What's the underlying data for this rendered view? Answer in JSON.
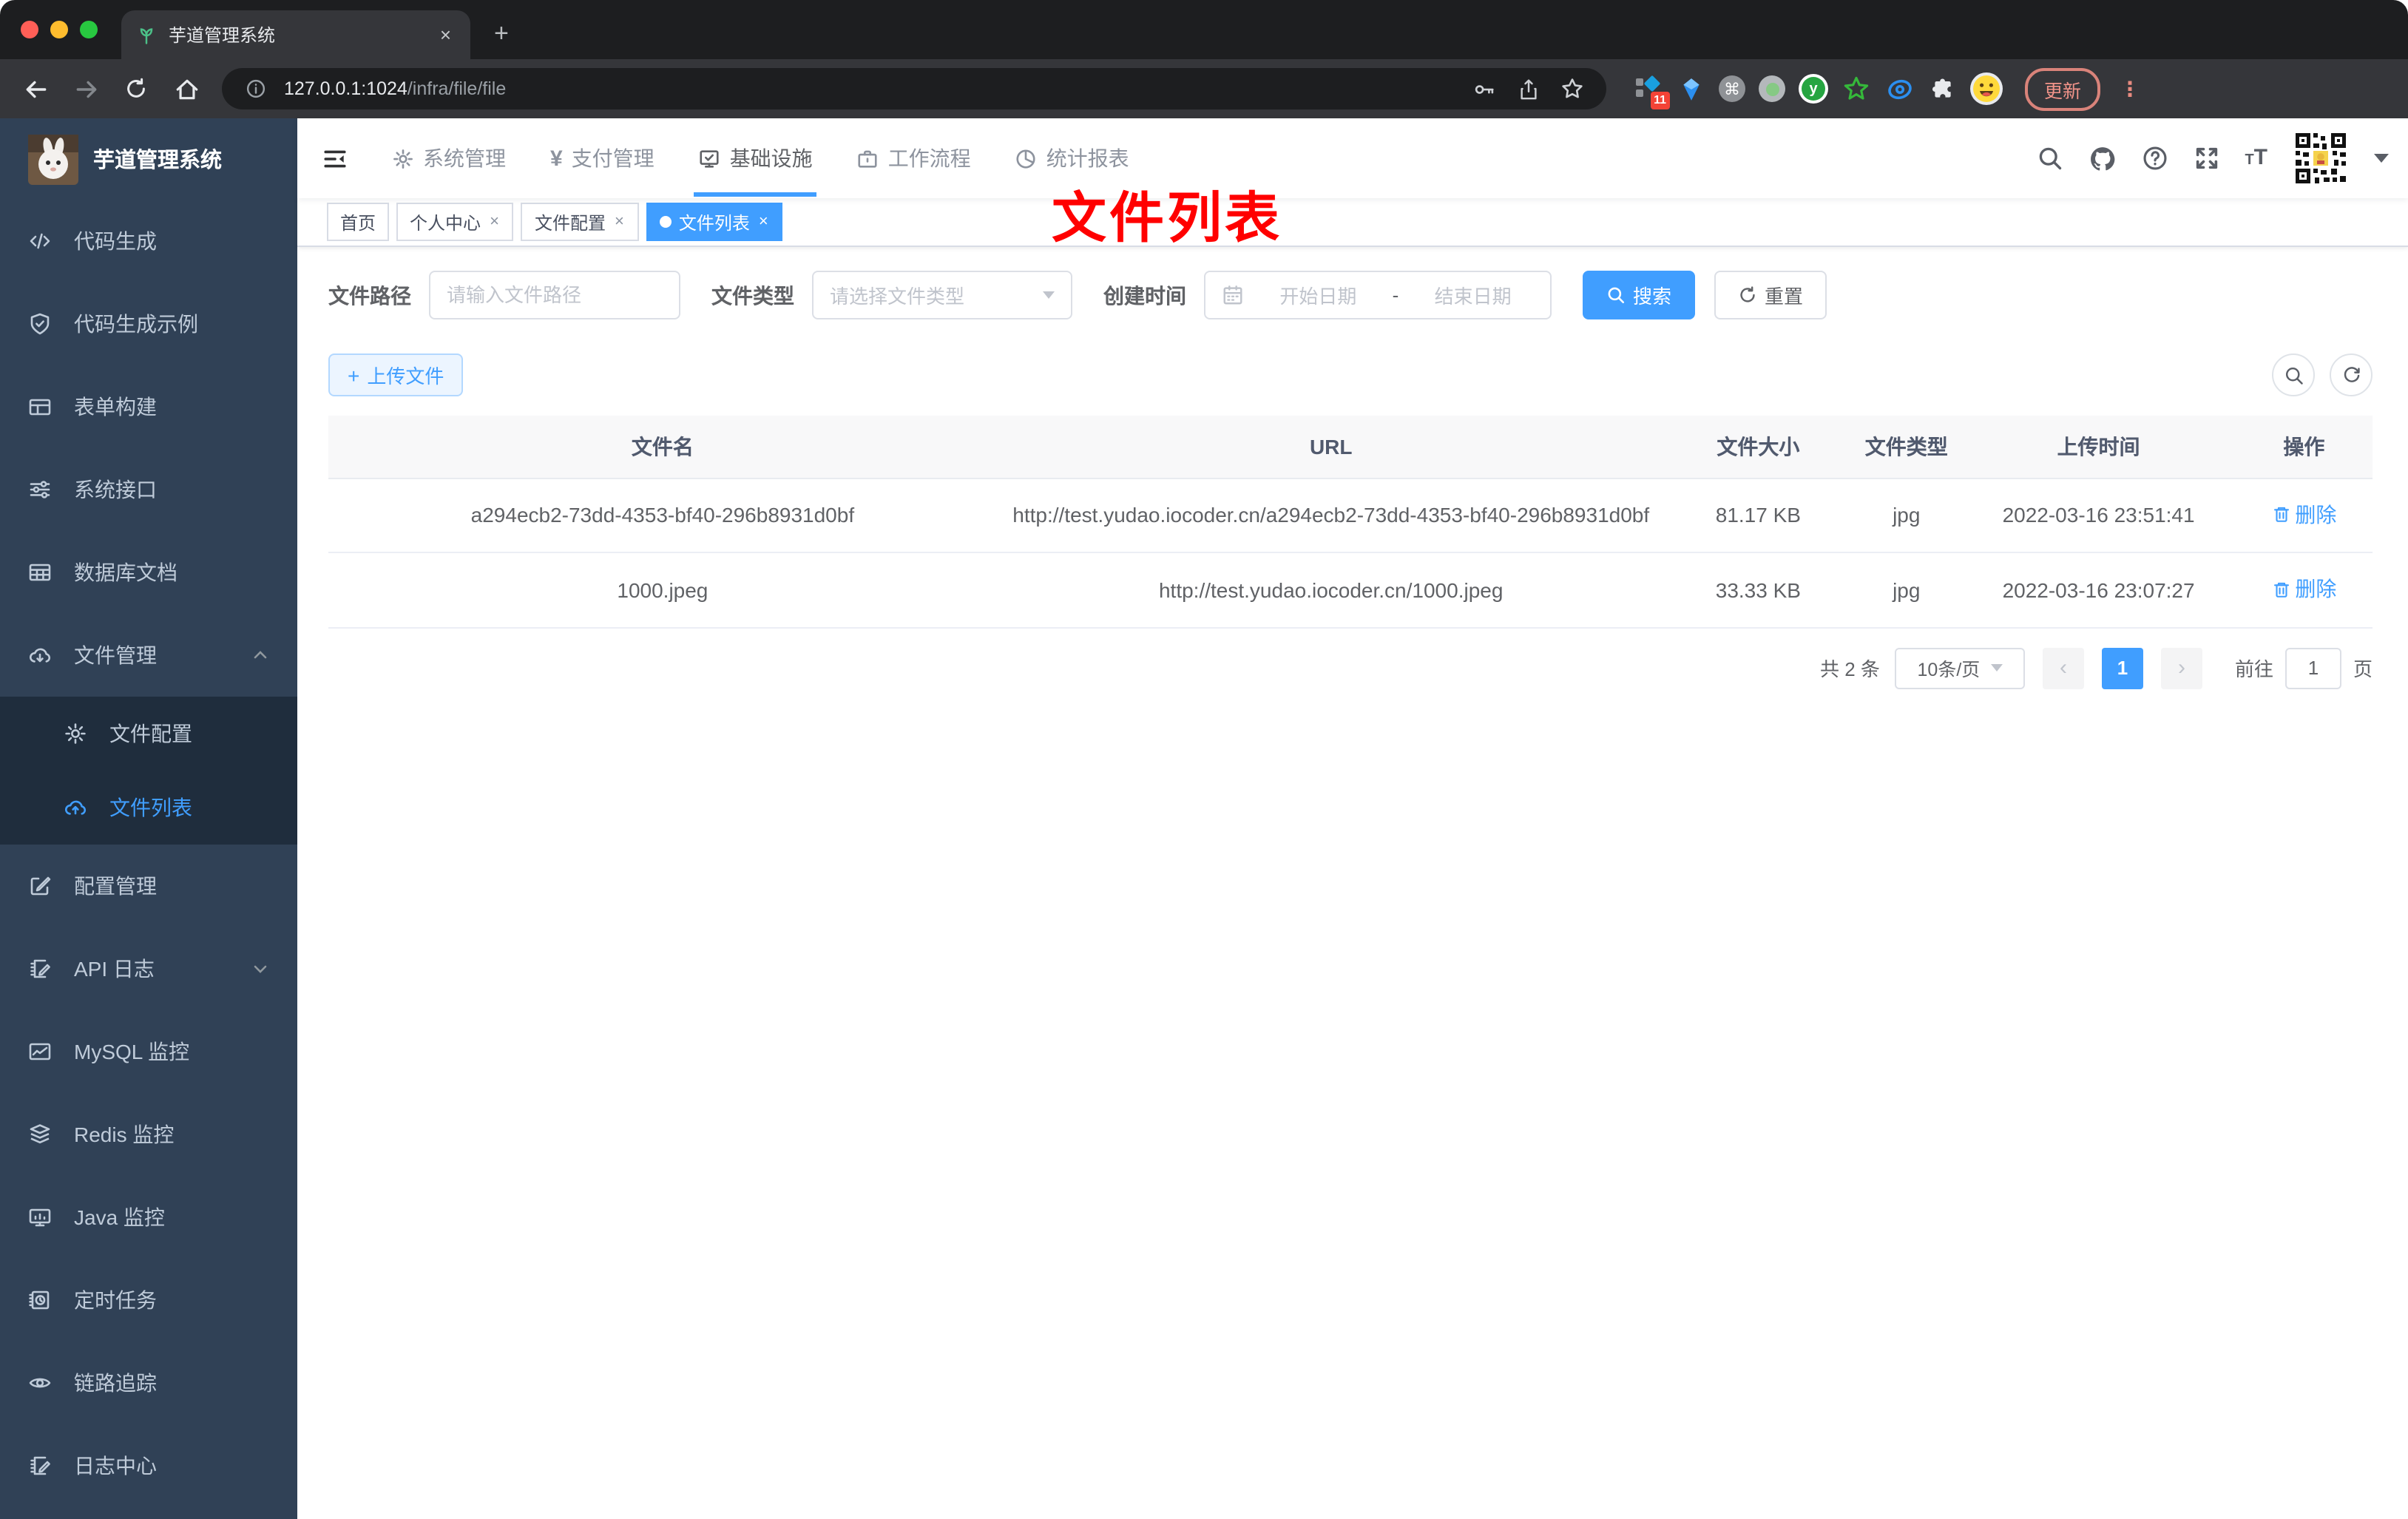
{
  "browser": {
    "tab_title": "芋道管理系统",
    "url_host": "127.0.0.1:1024",
    "url_path": "/infra/file/file",
    "update_label": "更新",
    "extension_badge": "11"
  },
  "icons": {
    "close": "×",
    "plus": "+",
    "more_vertical": "⋮",
    "chevron_left": "‹",
    "chevron_right": "›",
    "yen": "¥",
    "command": "⌘",
    "letter_t": "T",
    "letter_y": "y"
  },
  "sidebar": {
    "title": "芋道管理系统",
    "items": [
      {
        "label": "代码生成"
      },
      {
        "label": "代码生成示例"
      },
      {
        "label": "表单构建"
      },
      {
        "label": "系统接口"
      },
      {
        "label": "数据库文档"
      },
      {
        "label": "文件管理"
      },
      {
        "label": "文件配置"
      },
      {
        "label": "文件列表"
      },
      {
        "label": "配置管理"
      },
      {
        "label": "API 日志"
      },
      {
        "label": "MySQL 监控"
      },
      {
        "label": "Redis 监控"
      },
      {
        "label": "Java 监控"
      },
      {
        "label": "定时任务"
      },
      {
        "label": "链路追踪"
      },
      {
        "label": "日志中心"
      }
    ]
  },
  "topnav": {
    "items": [
      {
        "label": "系统管理"
      },
      {
        "label": "支付管理"
      },
      {
        "label": "基础设施"
      },
      {
        "label": "工作流程"
      },
      {
        "label": "统计报表"
      }
    ]
  },
  "tags": [
    {
      "label": "首页"
    },
    {
      "label": "个人中心"
    },
    {
      "label": "文件配置"
    },
    {
      "label": "文件列表"
    }
  ],
  "annotation": {
    "text": "文件列表",
    "color": "#ff0000"
  },
  "filters": {
    "path_label": "文件路径",
    "path_placeholder": "请输入文件路径",
    "type_label": "文件类型",
    "type_placeholder": "请选择文件类型",
    "date_label": "创建时间",
    "date_start_placeholder": "开始日期",
    "date_separator": "-",
    "date_end_placeholder": "结束日期",
    "search_label": "搜索",
    "reset_label": "重置"
  },
  "toolbar": {
    "upload_label": "上传文件"
  },
  "table": {
    "columns": [
      "文件名",
      "URL",
      "文件大小",
      "文件类型",
      "上传时间",
      "操作"
    ],
    "rows": [
      {
        "name": "a294ecb2-73dd-4353-bf40-296b8931d0bf",
        "url": "http://test.yudao.iocoder.cn/a294ecb2-73dd-4353-bf40-296b8931d0bf",
        "size": "81.17 KB",
        "type": "jpg",
        "time": "2022-03-16 23:51:41",
        "action": "删除"
      },
      {
        "name": "1000.jpeg",
        "url": "http://test.yudao.iocoder.cn/1000.jpeg",
        "size": "33.33 KB",
        "type": "jpg",
        "time": "2022-03-16 23:07:27",
        "action": "删除"
      }
    ]
  },
  "pagination": {
    "total": "共 2 条",
    "page_size": "10条/页",
    "current_page": "1",
    "goto_label": "前往",
    "goto_value": "1",
    "page_unit": "页"
  },
  "colors": {
    "accent": "#409eff",
    "sidebar_bg": "#304156",
    "submenu_bg": "#1f2d3d",
    "annotation_red": "#ff0000",
    "tag_active_bg": "#409eff"
  }
}
